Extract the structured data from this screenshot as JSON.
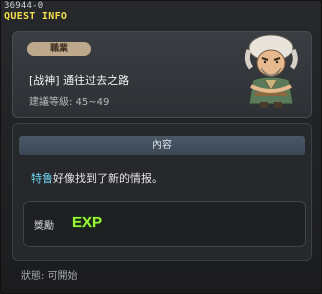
{
  "window": {
    "quest_id": "36944-0",
    "title": "QUEST INFO"
  },
  "quest": {
    "job_badge": "職業",
    "name": "[战神] 通往过去之路",
    "level": "建議等級: 45~49"
  },
  "contents": {
    "header": "內容",
    "npc_name": "特鲁",
    "text": "好像找到了新的情报。"
  },
  "reward": {
    "label": "獎勵",
    "icon": "exp-icon",
    "icon_text": "EXP",
    "icon_color": "#9ef53a"
  },
  "status": {
    "text": "狀態: 可開始"
  },
  "colors": {
    "title": "#f3de4c",
    "npc_name": "#6fd3f0",
    "badge": "#bea88c",
    "header": "#4a5868"
  }
}
